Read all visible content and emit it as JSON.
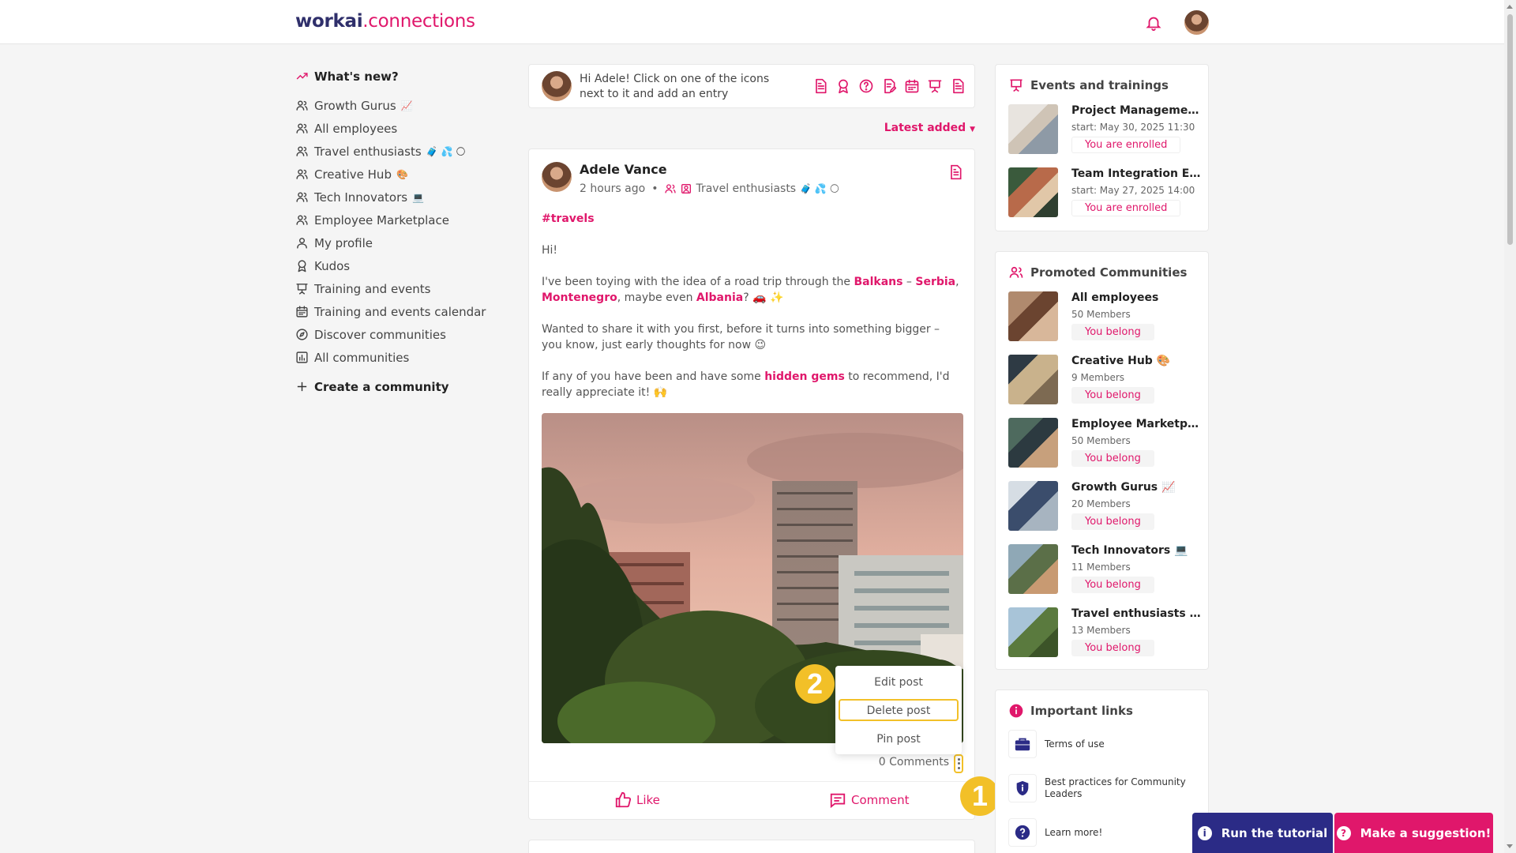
{
  "header": {
    "logo_part1": "workai",
    "logo_part2": ".connections"
  },
  "sidebar": {
    "whats_new": "What's new?",
    "items": [
      {
        "label": "Growth Gurus",
        "emoji": "📈",
        "icon": "people-icon"
      },
      {
        "label": "All employees",
        "emoji": "",
        "icon": "people-icon"
      },
      {
        "label": "Travel enthusiasts",
        "emoji": "🧳 💦 🌕",
        "icon": "people-icon"
      },
      {
        "label": "Creative Hub",
        "emoji": "🎨",
        "icon": "people-icon"
      },
      {
        "label": "Tech Innovators",
        "emoji": "💻",
        "icon": "people-icon"
      },
      {
        "label": "Employee Marketplace",
        "emoji": "",
        "icon": "people-icon"
      },
      {
        "label": "My profile",
        "emoji": "",
        "icon": "user-icon"
      },
      {
        "label": "Kudos",
        "emoji": "",
        "icon": "award-icon"
      },
      {
        "label": "Training and events",
        "emoji": "",
        "icon": "presentation-icon"
      },
      {
        "label": "Training and events calendar",
        "emoji": "",
        "icon": "calendar-icon"
      },
      {
        "label": "Discover communities",
        "emoji": "",
        "icon": "compass-icon"
      },
      {
        "label": "All communities",
        "emoji": "",
        "icon": "chart-icon"
      }
    ],
    "create_community": "Create a community"
  },
  "composer": {
    "prompt": "Hi Adele! Click on one of the icons next to it and add an entry",
    "icons": [
      "document-icon",
      "award-icon",
      "question-icon",
      "edit-document-icon",
      "calendar-icon",
      "presentation-icon",
      "document-icon"
    ]
  },
  "feed": {
    "sort_label": "Latest added"
  },
  "post": {
    "author": "Adele Vance",
    "time": "2 hours ago",
    "community": "Travel enthusiasts",
    "community_emoji": "🧳 💦 🌕",
    "hashtag": "#travels",
    "greeting": "Hi!",
    "p1_a": "I've been toying with the idea of a road trip through the ",
    "p1_balkans": "Balkans",
    "p1_dash": " – ",
    "p1_serbia": "Serbia",
    "p1_comma": ", ",
    "p1_montenegro": "Montenegro",
    "p1_b": ", maybe even ",
    "p1_albania": "Albania",
    "p1_c": "? 🚗 ✨",
    "p2": "Wanted to share it with you first, before it turns into something bigger – you know, just early thoughts for now 😉",
    "p3_a": "If any of you have been and have some ",
    "p3_gems": "hidden gems",
    "p3_b": " to recommend, I'd really appreciate it! 🙌",
    "comments_count": "0 Comments",
    "like_label": "Like",
    "comment_label": "Comment"
  },
  "post_menu": {
    "edit": "Edit post",
    "delete": "Delete post",
    "pin": "Pin post"
  },
  "tutorial_badges": {
    "step1": "1",
    "step2": "2"
  },
  "events": {
    "title": "Events and trainings",
    "items": [
      {
        "title": "Project Management Training",
        "start": "start: May 30, 2025 11:30",
        "status": "You are enrolled"
      },
      {
        "title": "Team Integration Event",
        "start": "start: May 27, 2025 14:00",
        "status": "You are enrolled"
      }
    ]
  },
  "communities": {
    "title": "Promoted Communities",
    "items": [
      {
        "name": "All employees",
        "members": "50 Members",
        "status": "You belong"
      },
      {
        "name": "Creative Hub 🎨",
        "members": "9 Members",
        "status": "You belong"
      },
      {
        "name": "Employee Marketplace",
        "members": "50 Members",
        "status": "You belong"
      },
      {
        "name": "Growth Gurus 📈",
        "members": "20 Members",
        "status": "You belong"
      },
      {
        "name": "Tech Innovators 💻",
        "members": "11 Members",
        "status": "You belong"
      },
      {
        "name": "Travel enthusiasts 🧳 💦 🌕",
        "members": "13 Members",
        "status": "You belong"
      }
    ]
  },
  "links": {
    "title": "Important links",
    "items": [
      {
        "label": "Terms of use",
        "icon": "briefcase-icon"
      },
      {
        "label": "Best practices for Community Leaders",
        "icon": "shield-icon"
      },
      {
        "label": "Learn more!",
        "icon": "question-icon"
      }
    ]
  },
  "buttons": {
    "tutorial": "Run the tutorial",
    "suggestion": "Make a suggestion!"
  },
  "colors": {
    "accent": "#e0176b",
    "navy": "#2b2b86",
    "highlight": "#f2c028"
  }
}
